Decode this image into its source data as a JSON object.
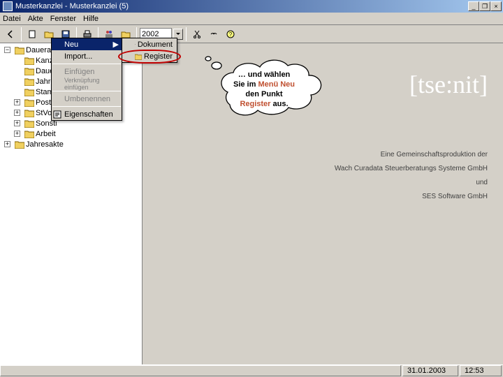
{
  "title": "Musterkanzlei - Musterkanzlei (5)",
  "window_buttons": {
    "min": "_",
    "max": "❐",
    "close": "×"
  },
  "menubar": [
    "Datei",
    "Akte",
    "Fenster",
    "Hilfe"
  ],
  "toolbar": {
    "year": "2002"
  },
  "tree": {
    "root": "Dauerakte",
    "items": [
      "Kanzle",
      "Dauer",
      "Jahres",
      "Stamm",
      "Postko",
      "StVo.A",
      "Sonsti",
      "Arbeit"
    ],
    "last": "Jahresakte"
  },
  "context_menu": {
    "neu": "Neu",
    "import": "Import...",
    "einfuegen": "Einfügen",
    "verknuepfung": "Verknüpfung einfügen",
    "umbenennen": "Umbenennen",
    "eigenschaften": "Eigenschaften"
  },
  "sub_menu": {
    "dokument": "Dokument",
    "register": "Register"
  },
  "cloud": {
    "line1": "… und wählen",
    "line2a": "Sie im ",
    "line2b": "Menü Neu",
    "line3": "den Punkt",
    "line4a": "Register",
    "line4b": " aus."
  },
  "logo": "[tse:nit]",
  "credits": {
    "l1": "Eine Gemeinschaftsproduktion der",
    "l2": "Wach Curadata Steuerberatungs Systeme GmbH",
    "l3": "und",
    "l4": "SES Software GmbH"
  },
  "status": {
    "date": "31.01.2003",
    "time": "12:53"
  }
}
